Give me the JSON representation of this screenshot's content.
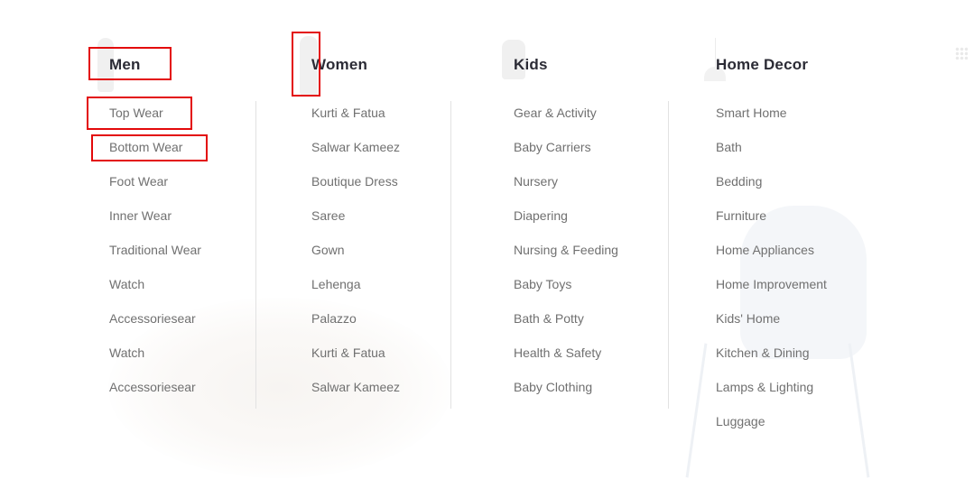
{
  "menu": {
    "columns": [
      {
        "title": "Men",
        "items": [
          "Top Wear",
          "Bottom Wear",
          "Foot Wear",
          "Inner Wear",
          "Traditional Wear",
          "Watch",
          "Accessoriesear",
          "Watch",
          "Accessoriesear"
        ]
      },
      {
        "title": "Women",
        "items": [
          "Kurti & Fatua",
          "Salwar Kameez",
          "Boutique Dress",
          "Saree",
          "Gown",
          "Lehenga",
          "Palazzo",
          "Kurti & Fatua",
          "Salwar Kameez"
        ]
      },
      {
        "title": "Kids",
        "items": [
          "Gear & Activity",
          "Baby Carriers",
          "Nursery",
          "Diapering",
          "Nursing & Feeding",
          "Baby Toys",
          "Bath & Potty",
          "Health & Safety",
          "Baby Clothing"
        ]
      },
      {
        "title": "Home Decor",
        "items": [
          "Smart Home",
          "Bath",
          "Bedding",
          "Furniture",
          "Home Appliances",
          "Home Improvement",
          "Kids' Home",
          "Kitchen & Dining",
          "Lamps & Lighting",
          "Luggage"
        ]
      }
    ]
  },
  "colors": {
    "heading": "#2b2b35",
    "item": "#707070",
    "highlight_box": "#e3090a",
    "divider": "#e2e2e2"
  }
}
